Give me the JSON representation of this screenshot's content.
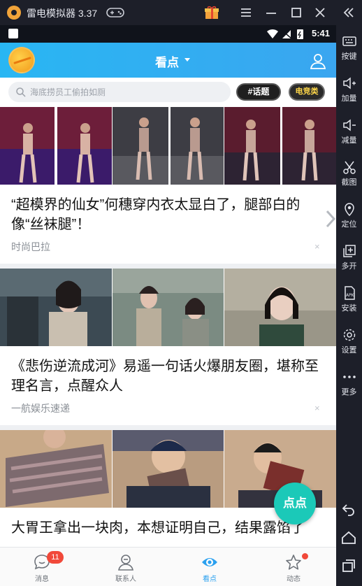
{
  "emulator": {
    "title": "雷电模拟器 3.37",
    "tools": [
      {
        "icon": "keyboard-icon",
        "label": "按键"
      },
      {
        "icon": "volume-up-icon",
        "label": "加量"
      },
      {
        "icon": "volume-down-icon",
        "label": "减量"
      },
      {
        "icon": "scissors-icon",
        "label": "截图"
      },
      {
        "icon": "location-pin-icon",
        "label": "定位"
      },
      {
        "icon": "multi-open-icon",
        "label": "多开"
      },
      {
        "icon": "apk-install-icon",
        "label": "安装"
      },
      {
        "icon": "gear-icon",
        "label": "设置"
      },
      {
        "icon": "more-dots-icon",
        "label": "更多"
      }
    ]
  },
  "status_bar": {
    "time": "5:41"
  },
  "app_bar": {
    "title": "看点"
  },
  "search": {
    "placeholder": "海底捞员工偷拍如厕",
    "topic_button": "#话题",
    "esports_button": "电竞类"
  },
  "feed": [
    {
      "title": "“超模界的仙女”何穗穿内衣太显白了，腿部白的像“丝袜腿”！",
      "source": "时尚巴拉",
      "dismiss": "×"
    },
    {
      "title": "《悲伤逆流成河》易遥一句话火爆朋友圈，堪称至理名言，点醒众人",
      "source": "一航娱乐速递",
      "dismiss": "×"
    },
    {
      "title": "大胃王拿出一块肉，本想证明自己，结果露馅了",
      "source": "",
      "dismiss": ""
    }
  ],
  "float_button": {
    "label": "点点"
  },
  "bottom_nav": [
    {
      "label": "消息",
      "badge": "11",
      "icon": "chat-bubble-icon"
    },
    {
      "label": "联系人",
      "icon": "contacts-icon"
    },
    {
      "label": "看点",
      "icon": "eye-icon",
      "active": true
    },
    {
      "label": "动态",
      "icon": "star-icon"
    }
  ],
  "colors": {
    "accent": "#2aa0ef",
    "float_button": "#1bc9b8",
    "badge": "#f1493a"
  }
}
